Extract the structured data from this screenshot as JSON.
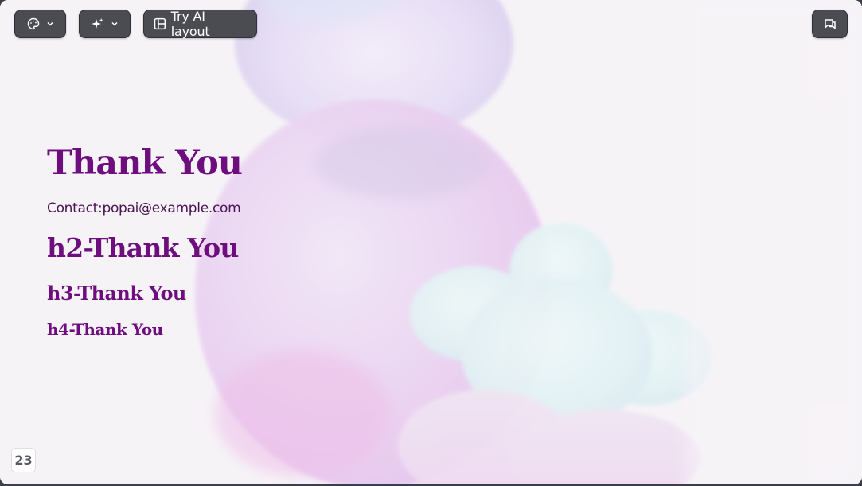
{
  "toolbar": {
    "theme_icon": "palette-icon",
    "magic_icon": "sparkles-icon",
    "layout_icon": "layout-icon",
    "layout_label": "Try AI layout",
    "comment_icon": "comment-icon",
    "chevron_icon": "chevron-down-icon"
  },
  "slide": {
    "h1": "Thank You",
    "contact": "Contact:popai@example.com",
    "h2": "h2-Thank You",
    "h3": "h3-Thank You",
    "h4": "h4-Thank You",
    "page_number": "23"
  },
  "colors": {
    "heading": "#6e0e7e",
    "contact_text": "#4a1452",
    "toolbar_bg": "#4a4c52",
    "slide_bg": "#f6f3f7"
  }
}
